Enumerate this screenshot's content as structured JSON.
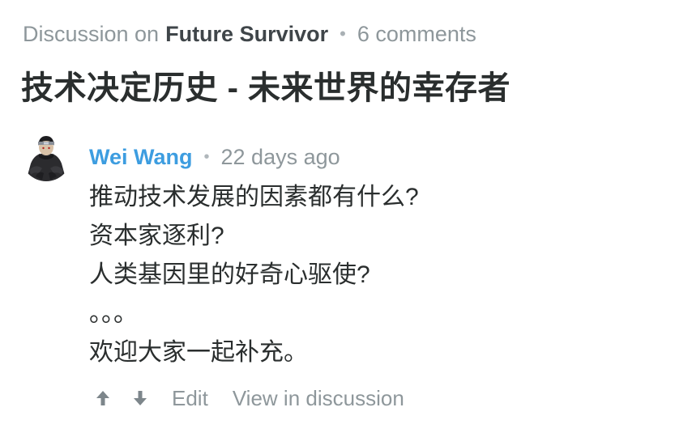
{
  "header": {
    "prefix": "Discussion on",
    "thread_name": "Future Survivor",
    "separator": "•",
    "comment_count": "6 comments"
  },
  "title": "技术决定历史 - 未来世界的幸存者",
  "comment": {
    "author": "Wei Wang",
    "separator": "•",
    "time": "22 days ago",
    "lines": [
      "推动技术发展的因素都有什么?",
      "资本家逐利?",
      "人类基因里的好奇心驱使?",
      "。。。",
      "欢迎大家一起补充。"
    ],
    "avatar_icon": "ninja-avatar"
  },
  "actions": {
    "upvote_icon": "arrow-up-icon",
    "downvote_icon": "arrow-down-icon",
    "edit_label": "Edit",
    "view_label": "View in discussion"
  },
  "colors": {
    "author": "#3d9de0",
    "muted": "#8e979b",
    "text": "#2a2e2e"
  }
}
